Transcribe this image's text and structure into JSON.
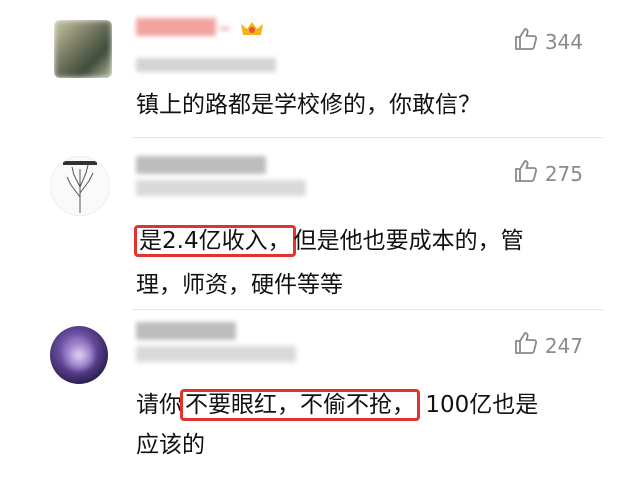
{
  "comments": [
    {
      "likes": "344",
      "text": "镇上的路都是学校修的，你敢信？"
    },
    {
      "likes": "275",
      "highlight": "是2.4亿收入，",
      "rest_line1": "但是他也要成本的，管",
      "line2": "理，师资，硬件等等"
    },
    {
      "likes": "247",
      "prefix": "请你",
      "highlight": "不要眼红，不偷不抢，",
      "rest_line1": "100亿也是",
      "line2": "应该的"
    }
  ],
  "icons": {
    "like": "thumbs-up-icon"
  },
  "colors": {
    "highlight_border": "#e0332c",
    "like_text": "#8a8a8a"
  }
}
